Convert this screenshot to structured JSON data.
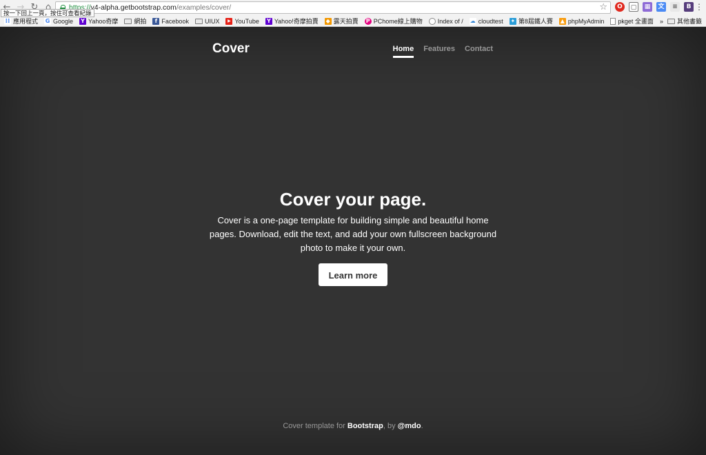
{
  "browser": {
    "url": {
      "scheme": "https://",
      "host": "v4-alpha.getbootstrap.com",
      "path": "/examples/cover/"
    },
    "tooltip": "按一下回上一頁，按住可查看紀錄",
    "bookmarks": [
      {
        "label": "應用程式",
        "icon": "apps-grid-icon"
      },
      {
        "label": "Google",
        "icon": "google-icon"
      },
      {
        "label": "Yahoo奇摩",
        "icon": "yahoo-icon"
      },
      {
        "label": "網拍",
        "icon": "folder-icon"
      },
      {
        "label": "Facebook",
        "icon": "facebook-icon"
      },
      {
        "label": "UIUX",
        "icon": "folder-icon"
      },
      {
        "label": "YouTube",
        "icon": "youtube-icon"
      },
      {
        "label": "Yahoo!奇摩拍賣",
        "icon": "yahoo-icon"
      },
      {
        "label": "露天拍賣",
        "icon": "ruten-icon"
      },
      {
        "label": "PChome線上購物",
        "icon": "pchome-icon"
      },
      {
        "label": "Index of /",
        "icon": "globe-icon"
      },
      {
        "label": "cloudtest",
        "icon": "cloud-icon"
      },
      {
        "label": "第8屆鐵人賽",
        "icon": "ithelp-icon"
      },
      {
        "label": "phpMyAdmin",
        "icon": "phpmyadmin-icon"
      },
      {
        "label": "pkget 全畫面",
        "icon": "page-icon"
      }
    ],
    "other_bookmarks": "其他書籤"
  },
  "site": {
    "brand": "Cover",
    "nav": [
      "Home",
      "Features",
      "Contact"
    ]
  },
  "hero": {
    "title": "Cover your page.",
    "lead": "Cover is a one-page template for building simple and beautiful home pages. Download, edit the text, and add your own fullscreen background photo to make it your own.",
    "button": "Learn more"
  },
  "footer": {
    "prefix": "Cover template for ",
    "link1": "Bootstrap",
    "middle": ", by ",
    "link2": "@mdo",
    "suffix": "."
  },
  "colors": {
    "background": "#333333",
    "text": "#ffffff",
    "muted": "rgba(255,255,255,0.5)"
  }
}
